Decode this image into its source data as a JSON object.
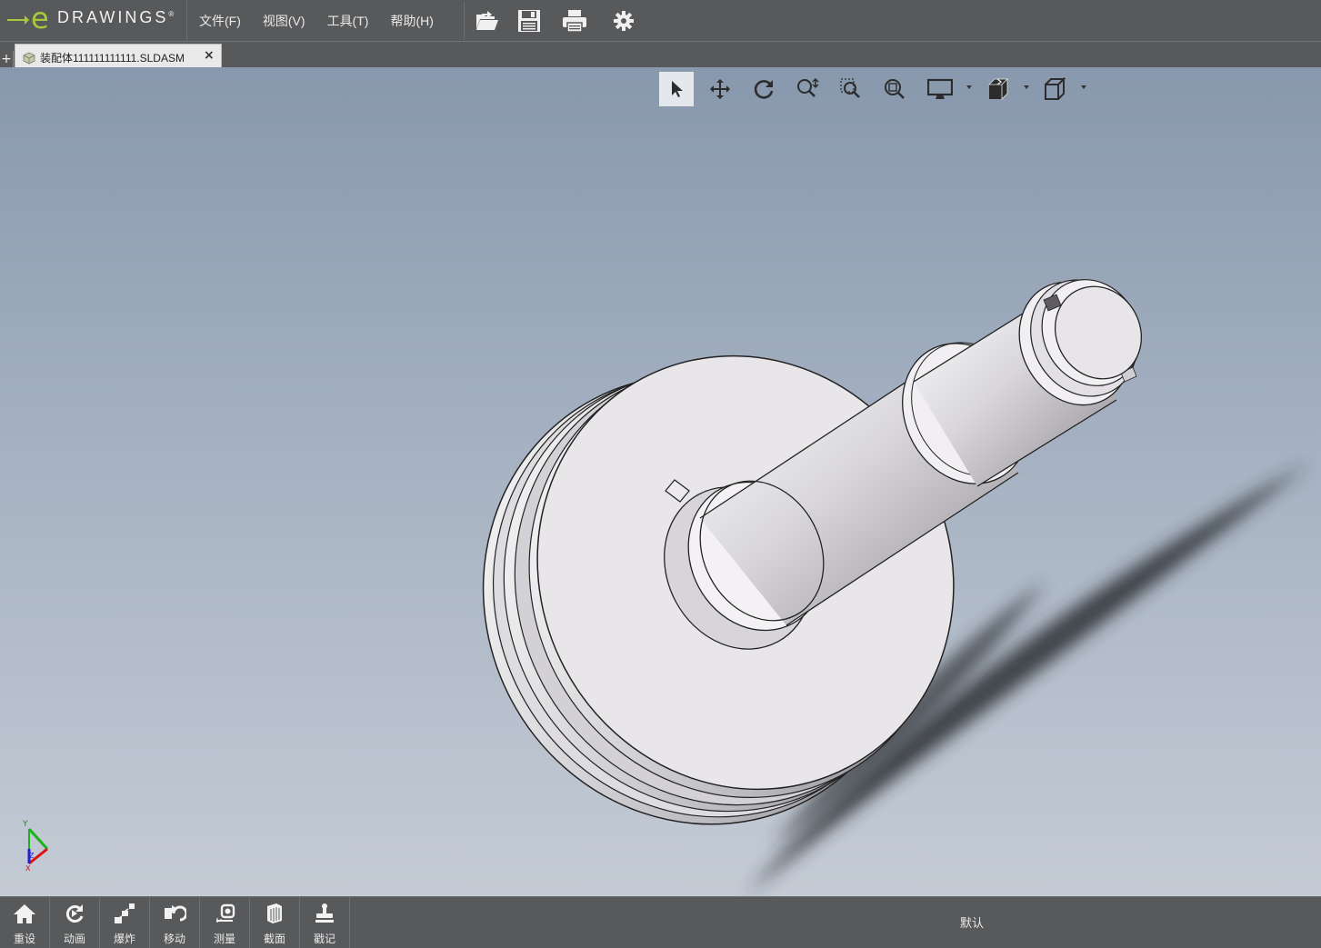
{
  "app": {
    "logo_letter": "e",
    "logo_name": "DRAWINGS",
    "logo_mark": "®"
  },
  "menu": [
    {
      "label": "文件(F)"
    },
    {
      "label": "视图(V)"
    },
    {
      "label": "工具(T)"
    },
    {
      "label": "帮助(H)"
    }
  ],
  "toolbar_icons": [
    "open-icon",
    "save-icon",
    "print-icon",
    "settings-gear-icon"
  ],
  "tabs": {
    "add_symbol": "+",
    "active": {
      "label": "装配体111111111111.SLDASM",
      "close_symbol": "×",
      "icon": "assembly-icon"
    }
  },
  "view_toolbar": [
    {
      "name": "select-icon",
      "active": true
    },
    {
      "name": "pan-icon"
    },
    {
      "name": "rotate-icon"
    },
    {
      "name": "zoom-icon"
    },
    {
      "name": "zoom-to-area-icon"
    },
    {
      "name": "zoom-to-fit-icon"
    },
    {
      "name": "display-style-icon",
      "dropdown": true
    },
    {
      "name": "view-orientation-icon",
      "dropdown": true
    },
    {
      "name": "standard-views-icon",
      "dropdown": true
    }
  ],
  "triad": {
    "y_label": "Y",
    "x_label": "X",
    "z_label": "Z"
  },
  "bottom_tools": [
    {
      "label": "重设",
      "icon": "home-icon"
    },
    {
      "label": "动画",
      "icon": "animate-icon"
    },
    {
      "label": "爆炸",
      "icon": "explode-icon"
    },
    {
      "label": "移动",
      "icon": "move-icon"
    },
    {
      "label": "测量",
      "icon": "measure-icon"
    },
    {
      "label": "截面",
      "icon": "section-icon"
    },
    {
      "label": "戳记",
      "icon": "stamp-icon"
    }
  ],
  "status": {
    "configuration": "默认"
  },
  "colors": {
    "chrome": "#58595b",
    "accent": "#a6c93a",
    "model_face": "#e9e7eb",
    "viewport_top": "#8898ad",
    "viewport_bottom": "#c4cbd5"
  }
}
